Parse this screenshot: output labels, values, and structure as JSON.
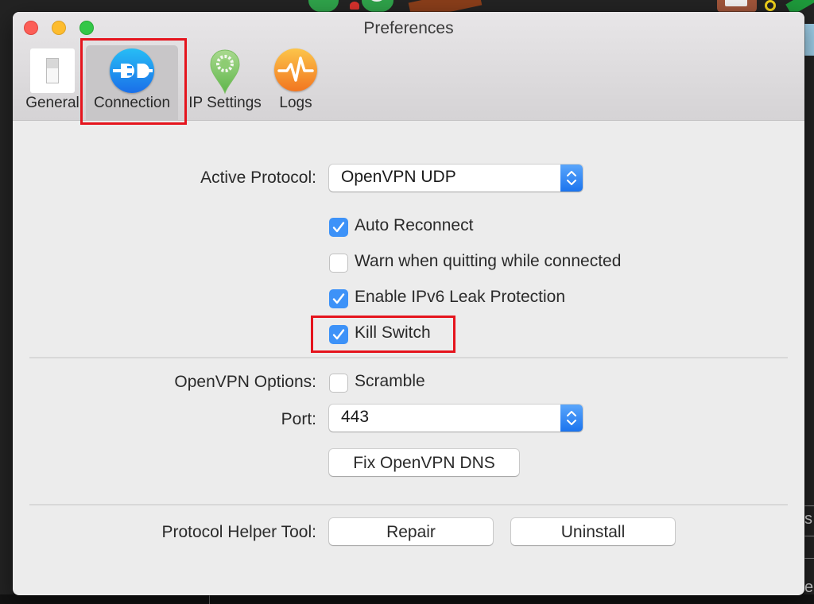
{
  "window": {
    "title": "Preferences"
  },
  "toolbar": {
    "tabs": [
      {
        "id": "general",
        "label": "General",
        "icon": "toggle-switch-icon",
        "selected": false
      },
      {
        "id": "connection",
        "label": "Connection",
        "icon": "plug-icon",
        "selected": true
      },
      {
        "id": "ip-settings",
        "label": "IP Settings",
        "icon": "location-gear-icon",
        "selected": false
      },
      {
        "id": "logs",
        "label": "Logs",
        "icon": "pulse-icon",
        "selected": false
      }
    ]
  },
  "connection": {
    "active_protocol": {
      "label": "Active Protocol:",
      "value": "OpenVPN UDP"
    },
    "options": [
      {
        "label": "Auto Reconnect",
        "checked": true
      },
      {
        "label": "Warn when quitting while connected",
        "checked": false
      },
      {
        "label": "Enable IPv6 Leak Protection",
        "checked": true
      },
      {
        "label": "Kill Switch",
        "checked": true
      }
    ],
    "openvpn_options": {
      "label": "OpenVPN Options:",
      "scramble_label": "Scramble",
      "scramble_checked": false
    },
    "port": {
      "label": "Port:",
      "value": "443"
    },
    "fix_dns_button": "Fix OpenVPN DNS",
    "helper_tool": {
      "label": "Protocol Helper Tool:",
      "repair_button": "Repair",
      "uninstall_button": "Uninstall"
    }
  },
  "annotations": {
    "highlight_color": "#e5141d",
    "highlighted": [
      "Connection tab",
      "Kill Switch"
    ]
  },
  "background": {
    "edge_text_1": "s",
    "edge_text_2": "e"
  }
}
